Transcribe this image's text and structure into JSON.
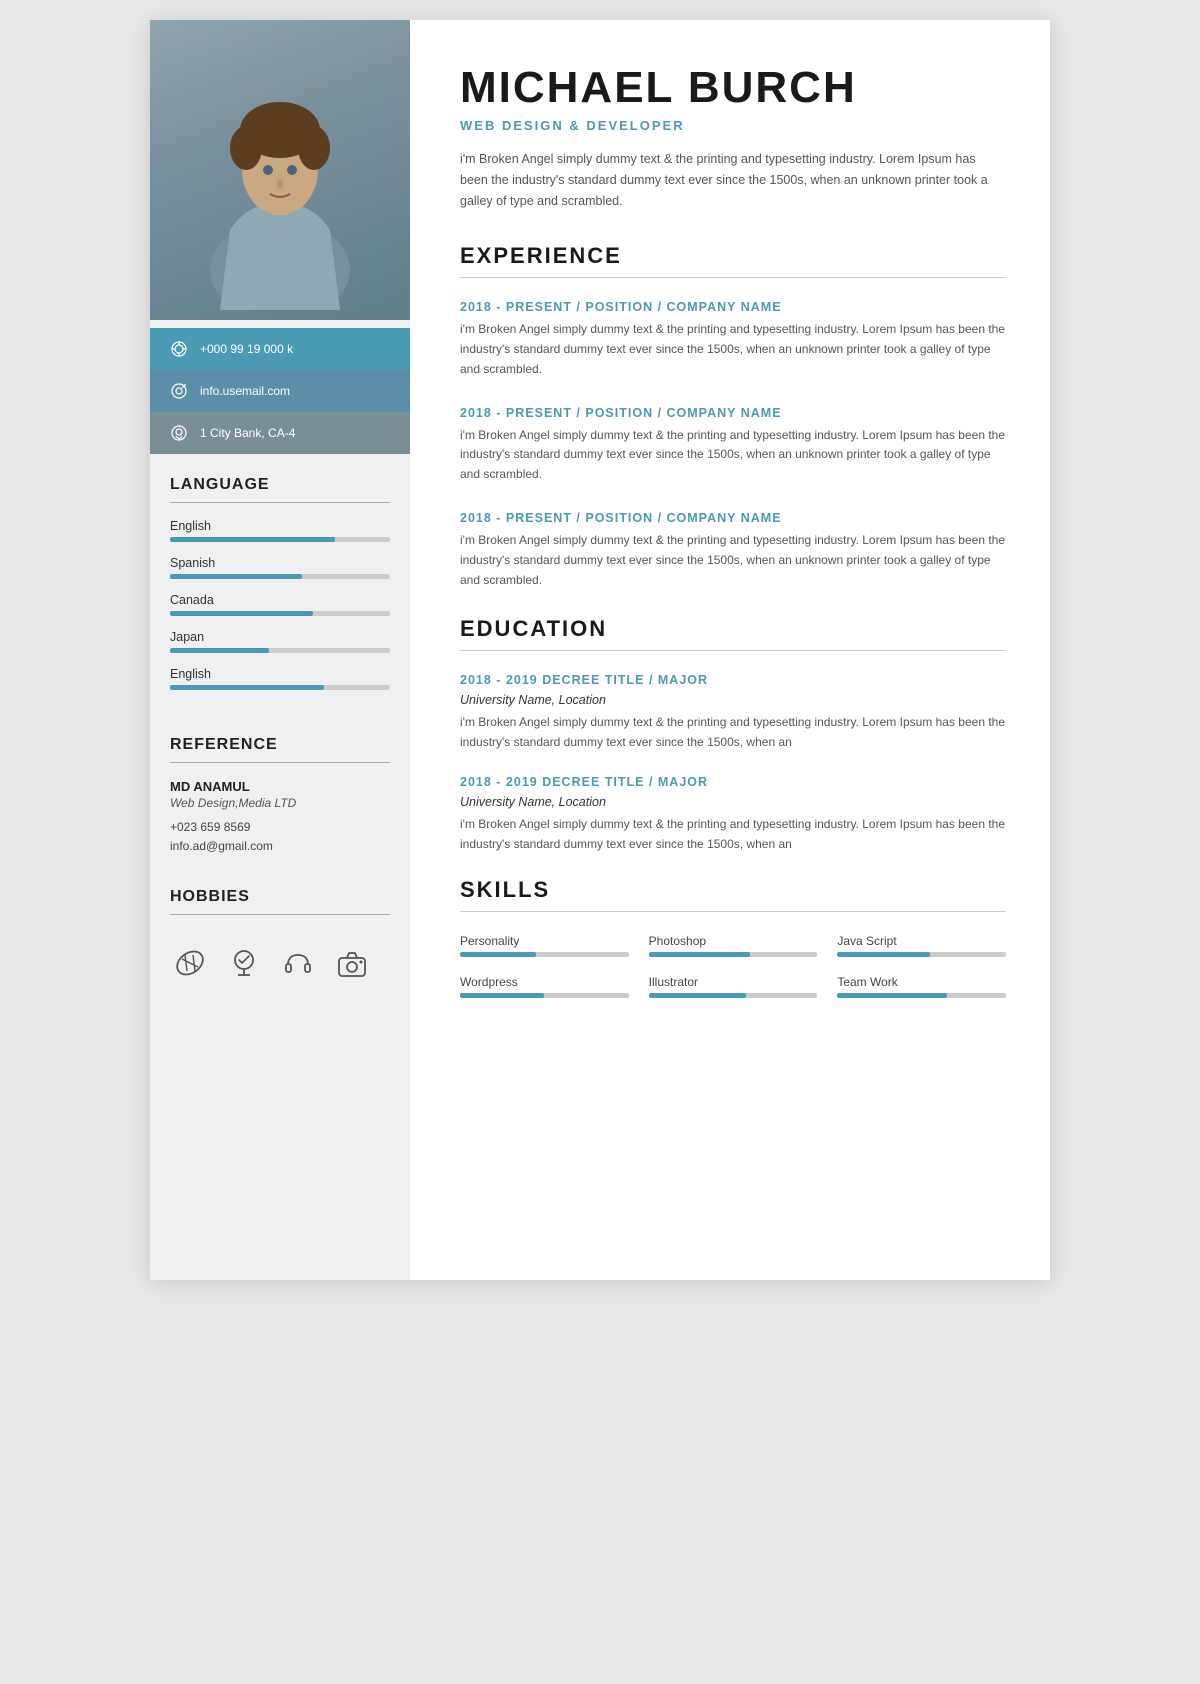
{
  "person": {
    "name": "MICHAEL BURCH",
    "title": "WEB DESIGN & DEVELOPER",
    "intro": "i'm Broken Angel simply dummy text & the printing and typesetting industry. Lorem Ipsum has been the industry's standard dummy text ever since the 1500s, when an unknown printer took a galley of type and scrambled."
  },
  "contact": {
    "phone": "+000 99 19 000 k",
    "email": "info.usemail.com",
    "address": "1 City Bank, CA-4"
  },
  "languages": [
    {
      "name": "English",
      "percent": 75
    },
    {
      "name": "Spanish",
      "percent": 60
    },
    {
      "name": "Canada",
      "percent": 65
    },
    {
      "name": "Japan",
      "percent": 45
    },
    {
      "name": "English",
      "percent": 70
    }
  ],
  "reference": {
    "name": "MD ANAMUL",
    "company": "Web Design,Media LTD",
    "phone": "+023 659 8569",
    "email": "info.ad@gmail.com"
  },
  "hobbies": {
    "title": "HOBBIES",
    "icons": [
      "football-icon",
      "award-icon",
      "headphone-icon",
      "camera-icon"
    ]
  },
  "experience": {
    "section_title": "EXPERIENCE",
    "entries": [
      {
        "title": "2018 - PRESENT / POSITION / COMPANY NAME",
        "body": "i'm Broken Angel simply dummy text & the printing and typesetting industry. Lorem Ipsum has been the industry's standard dummy text ever since the 1500s, when an unknown printer took a galley of type and scrambled."
      },
      {
        "title": "2018 - PRESENT / POSITION / COMPANY NAME",
        "body": "i'm Broken Angel simply dummy text & the printing and typesetting industry. Lorem Ipsum has been the industry's standard dummy text ever since the 1500s, when an unknown printer took a galley of type and scrambled."
      },
      {
        "title": "2018 - PRESENT / POSITION / COMPANY NAME",
        "body": "i'm Broken Angel simply dummy text & the printing and typesetting industry. Lorem Ipsum has been the industry's standard dummy text ever since the 1500s, when an unknown printer took a galley of type and scrambled."
      }
    ]
  },
  "education": {
    "section_title": "EDUCATION",
    "entries": [
      {
        "title": "2018 - 2019 DECREE TITLE / MAJOR",
        "subtitle": "University Name, Location",
        "body": "i'm Broken Angel simply dummy text & the printing and typesetting industry. Lorem Ipsum has been the industry's standard dummy text ever since the 1500s, when an"
      },
      {
        "title": "2018 - 2019 DECREE TITLE / MAJOR",
        "subtitle": "University Name, Location",
        "body": "i'm Broken Angel simply dummy text & the printing and typesetting industry. Lorem Ipsum has been the industry's standard dummy text ever since the 1500s, when an"
      }
    ]
  },
  "skills": {
    "section_title": "SKILLS",
    "items": [
      {
        "label": "Personality",
        "percent": 45
      },
      {
        "label": "Photoshop",
        "percent": 60
      },
      {
        "label": "Java Script",
        "percent": 55
      },
      {
        "label": "Wordpress",
        "percent": 50
      },
      {
        "label": "Illustrator",
        "percent": 58
      },
      {
        "label": "Team Work",
        "percent": 65
      }
    ]
  },
  "sections": {
    "language_title": "LANGUAGE",
    "reference_title": "REFERENCE"
  }
}
